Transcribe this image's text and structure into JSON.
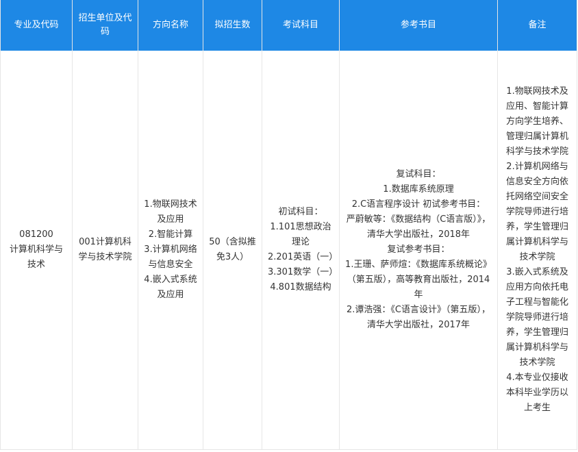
{
  "headers": [
    "专业及代码",
    "招生单位及代码",
    "方向名称",
    "拟招生数",
    "考试科目",
    "参考书目",
    "备注"
  ],
  "row": {
    "major": [
      "081200",
      "计算机科学与技术"
    ],
    "unit": "001计算机科学与技术学院",
    "directions": [
      "1.物联网技术及应用",
      "2.智能计算",
      "3.计算机网络与信息安全",
      "4.嵌入式系统及应用"
    ],
    "quota": "50（含拟推免3人）",
    "exam": [
      "初试科目：",
      "1.101思想政治理论",
      "2.201英语（一）",
      "3.301数学（一）",
      "4.801数据结构"
    ],
    "books": [
      "复试科目：",
      "1.数据库系统原理",
      "2.C语言程序设计 初试参考书目：",
      "严蔚敏等：《数据结构（C语言版）》，清华大学出版社，2018年",
      "复试参考书目：",
      "1.王珊、萨师煊：《数据库系统概论》（第五版），高等教育出版社，2014年",
      "2.谭浩强：《C语言设计》（第五版），清华大学出版社，2017年"
    ],
    "notes": [
      "1.物联网技术及应用、智能计算方向学生培养、管理归属计算机科学与技术学院",
      "2.计算机网络与信息安全方向依托网络空间安全学院导师进行培养，学生管理归属计算机科学与技术学院",
      "3.嵌入式系统及应用方向依托电子工程与智能化学院导师进行培养，学生管理归属计算机科学与技术学院",
      "4.本专业仅接收本科毕业学历以上考生"
    ]
  }
}
